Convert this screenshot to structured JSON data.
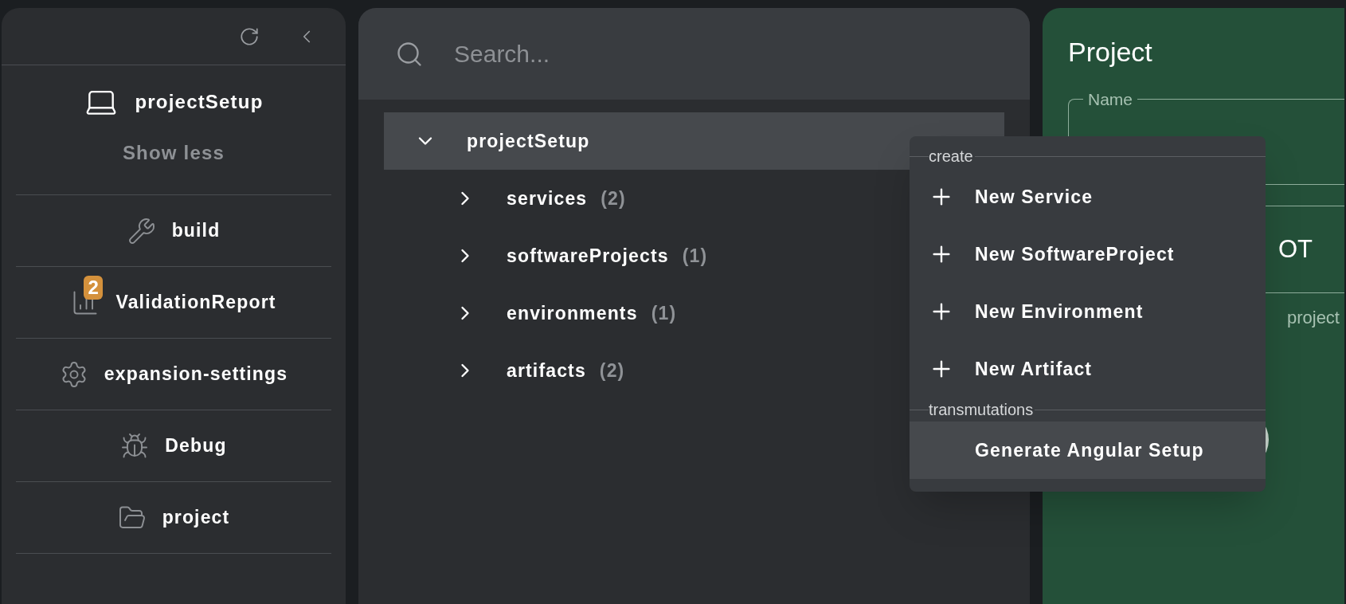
{
  "sidebar": {
    "current": {
      "label": "projectSetup"
    },
    "toggle": "Show less",
    "items": [
      {
        "label": "build"
      },
      {
        "label": "ValidationReport",
        "badge": "2"
      },
      {
        "label": "expansion-settings"
      },
      {
        "label": "Debug"
      },
      {
        "label": "project"
      }
    ]
  },
  "search": {
    "placeholder": "Search..."
  },
  "tree": [
    {
      "label": "projectSetup",
      "expanded": true,
      "selected": true,
      "children": [
        {
          "label": "services",
          "count": "(2)",
          "expanded": false,
          "selected": false
        },
        {
          "label": "softwareProjects",
          "count": "(1)",
          "expanded": false,
          "selected": false
        },
        {
          "label": "environments",
          "count": "(1)",
          "expanded": false,
          "selected": false
        },
        {
          "label": "artifacts",
          "count": "(2)",
          "expanded": false,
          "selected": false
        }
      ]
    }
  ],
  "details": {
    "title": "Project",
    "name_field": {
      "label": "Name"
    },
    "field_2": {
      "value_fragment": "OT",
      "hint_fragment": "project"
    }
  },
  "context_menu": {
    "sections": [
      {
        "header": "create",
        "items": [
          {
            "label": "New Service",
            "kind": "add",
            "selected": false
          },
          {
            "label": "New SoftwareProject",
            "kind": "add",
            "selected": false
          },
          {
            "label": "New Environment",
            "kind": "add",
            "selected": false
          },
          {
            "label": "New Artifact",
            "kind": "add",
            "selected": false
          }
        ]
      },
      {
        "header": "transmutations",
        "items": [
          {
            "label": "Generate Angular Setup",
            "kind": "action",
            "selected": true
          }
        ]
      }
    ]
  }
}
